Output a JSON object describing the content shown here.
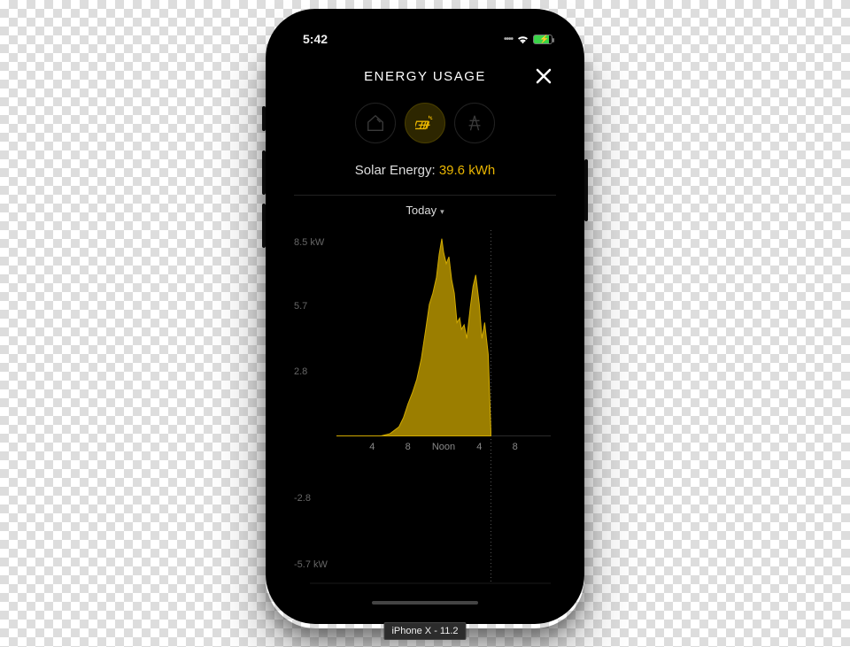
{
  "statusbar": {
    "time": "5:42"
  },
  "header": {
    "title": "ENERGY USAGE"
  },
  "tabs": {
    "active_index": 1
  },
  "metric": {
    "label": "Solar Energy: ",
    "value": "39.6 kWh"
  },
  "period": {
    "label": "Today"
  },
  "badge": {
    "text": "iPhone X - 11.2"
  },
  "chart_data": {
    "type": "area",
    "title": "",
    "xlabel": "",
    "ylabel": "",
    "y_ticks": [
      -5.7,
      -2.8,
      0,
      2.8,
      5.7,
      8.5
    ],
    "y_tick_labels": [
      "-5.7 kW",
      "-2.8",
      "",
      "2.8",
      "5.7",
      "8.5 kW"
    ],
    "x_ticks": [
      4,
      8,
      12,
      16,
      20
    ],
    "x_tick_labels": [
      "4",
      "8",
      "Noon",
      "4",
      "8"
    ],
    "ylim": [
      -6.5,
      9.0
    ],
    "xlim": [
      0,
      24
    ],
    "now_x": 17.3,
    "series": [
      {
        "name": "Solar",
        "color": "#b89500",
        "x": [
          0,
          5,
          6,
          7,
          7.5,
          8,
          8.5,
          9,
          9.5,
          10,
          10.4,
          10.8,
          11.2,
          11.5,
          11.8,
          12,
          12.3,
          12.6,
          12.9,
          13.2,
          13.5,
          13.8,
          14,
          14.3,
          14.6,
          15,
          15.3,
          15.6,
          16,
          16.3,
          16.6,
          17,
          17.3
        ],
        "values": [
          0,
          0,
          0.1,
          0.4,
          0.8,
          1.4,
          1.9,
          2.5,
          3.4,
          4.7,
          5.8,
          6.3,
          7.0,
          8.0,
          8.7,
          8.1,
          7.6,
          7.9,
          6.9,
          6.3,
          5.0,
          5.2,
          4.7,
          4.9,
          4.3,
          5.7,
          6.6,
          7.1,
          5.8,
          4.3,
          5.0,
          3.6,
          0.2
        ]
      }
    ]
  }
}
